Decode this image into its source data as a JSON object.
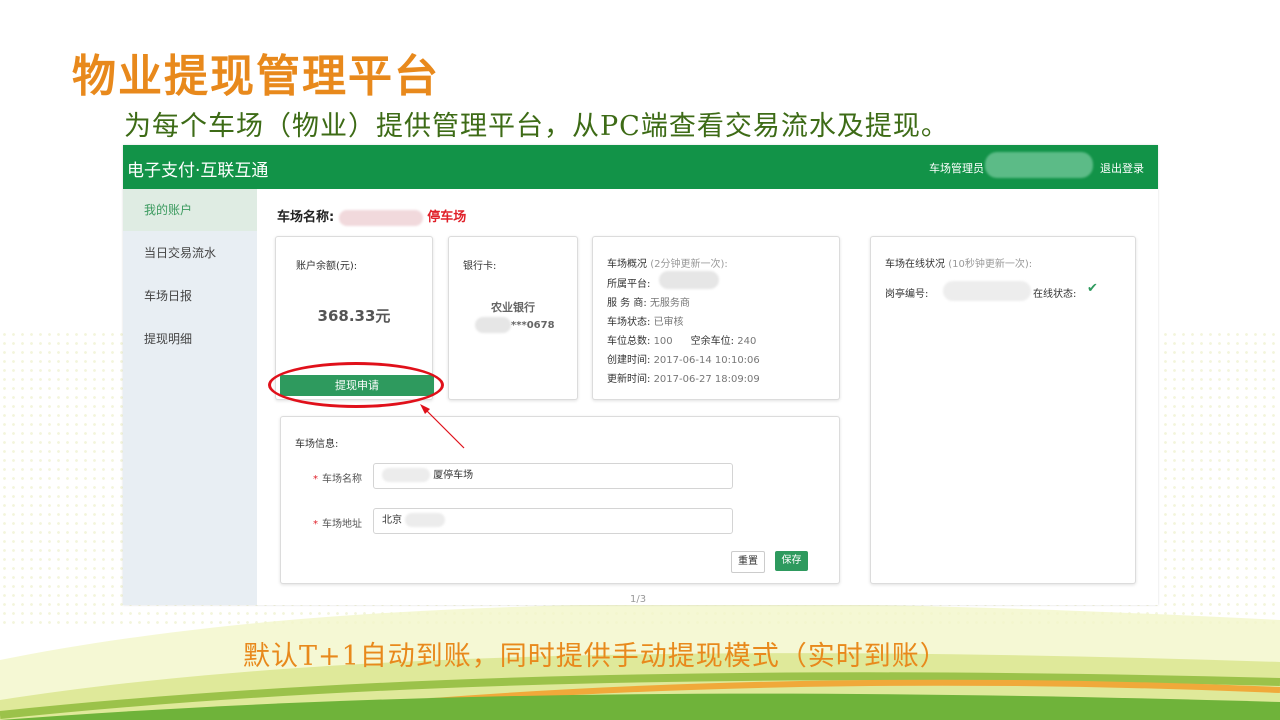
{
  "slide": {
    "title": "物业提现管理平台",
    "subtitle": "为每个车场（物业）提供管理平台，从PC端查看交易流水及提现。",
    "footer": "默认T+1自动到账，同时提供手动提现模式（实时到账）",
    "page_indicator": "1/3"
  },
  "topbar": {
    "brand": "电子支付·互联互通",
    "admin_label": "车场管理员",
    "logout": "退出登录"
  },
  "sidebar": {
    "items": [
      {
        "label": "我的账户",
        "active": true
      },
      {
        "label": "当日交易流水",
        "active": false
      },
      {
        "label": "车场日报",
        "active": false
      },
      {
        "label": "提现明细",
        "active": false
      }
    ]
  },
  "main": {
    "lot_title_label": "车场名称:",
    "lot_title_value": "停车场",
    "account": {
      "balance_label": "账户余额(元):",
      "balance": "368.33元",
      "withdraw_button": "提现申请"
    },
    "bank": {
      "label": "银行卡:",
      "bank_name": "农业银行",
      "card_suffix": "***0678"
    },
    "overview": {
      "label": "车场概况",
      "note": "(2分钟更新一次):",
      "platform_label": "所属平台:",
      "provider_label": "服 务 商:",
      "provider_value": "无服务商",
      "status_label": "车场状态:",
      "status_value": "已审核",
      "total_label": "车位总数:",
      "total_value": "100",
      "free_label": "空余车位:",
      "free_value": "240",
      "created_label": "创建时间:",
      "created_value": "2017-06-14 10:10:06",
      "updated_label": "更新时间:",
      "updated_value": "2017-06-27 18:09:09"
    },
    "online": {
      "label": "车场在线状况",
      "note": "(10秒钟更新一次):",
      "booth_label": "岗亭编号:",
      "status_label": "在线状态:",
      "status_icon": "check-icon"
    },
    "info_form": {
      "label": "车场信息:",
      "name_label": "车场名称",
      "name_value": "厦停车场",
      "address_label": "车场地址",
      "address_value": "北京",
      "reset_button": "重置",
      "save_button": "保存"
    }
  },
  "colors": {
    "header_green": "#129348",
    "accent_orange": "#e8891c",
    "subtitle_green": "#3d6b16",
    "highlight_red": "#e0101a"
  }
}
